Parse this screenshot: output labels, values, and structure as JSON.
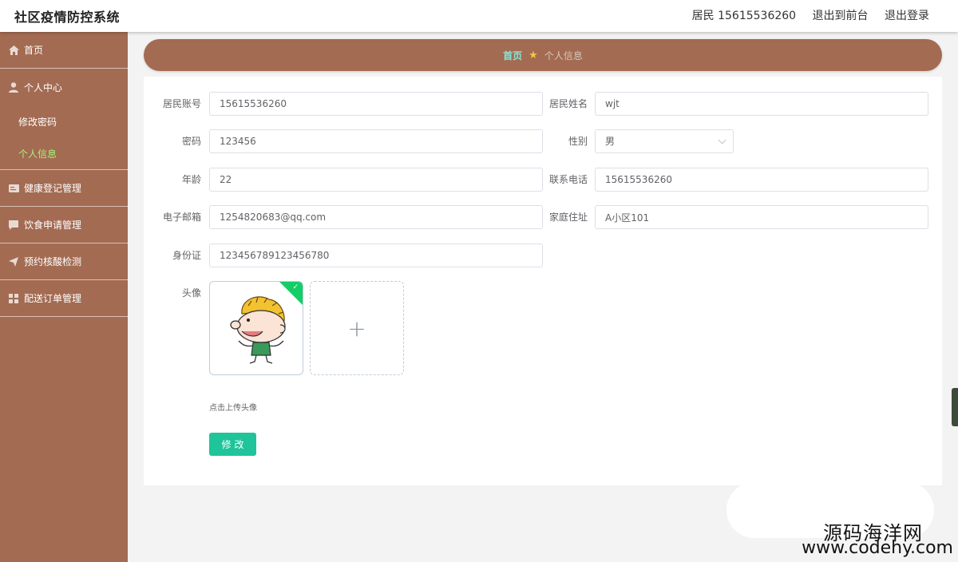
{
  "header": {
    "app_title": "社区疫情防控系统",
    "user_label": "居民 15615536260",
    "to_front": "退出到前台",
    "logout": "退出登录"
  },
  "sidebar": {
    "home": "首页",
    "personal_center": "个人中心",
    "change_password": "修改密码",
    "personal_info": "个人信息",
    "health_register": "健康登记管理",
    "diet_apply": "饮食申请管理",
    "appointment_test": "预约核酸检测",
    "delivery_orders": "配送订单管理"
  },
  "breadcrumb": {
    "home": "首页",
    "current": "个人信息"
  },
  "form": {
    "account_label": "居民账号",
    "account_value": "15615536260",
    "name_label": "居民姓名",
    "name_value": "wjt",
    "password_label": "密码",
    "password_value": "123456",
    "gender_label": "性别",
    "gender_value": "男",
    "age_label": "年龄",
    "age_value": "22",
    "phone_label": "联系电话",
    "phone_value": "15615536260",
    "email_label": "电子邮箱",
    "email_value": "1254820683@qq.com",
    "address_label": "家庭住址",
    "address_value": "A小区101",
    "idcard_label": "身份证",
    "idcard_value": "123456789123456780",
    "avatar_label": "头像",
    "upload_hint": "点击上传头像",
    "submit": "修改"
  },
  "watermark": {
    "cn": "源码海洋网",
    "url": "www.codehy.com"
  },
  "colors": {
    "sidebar_bg": "#a36b52",
    "active_sub": "#a8f07a",
    "breadcrumb_home": "#86e6d9",
    "primary_button": "#1fc49a",
    "upload_success": "#13ce66"
  },
  "icons": {
    "home": "home-icon",
    "personal_center": "person-icon",
    "health_register": "card-icon",
    "diet_apply": "chat-icon",
    "appointment_test": "send-icon",
    "delivery_orders": "grid-icon",
    "breadcrumb_sep": "star-icon",
    "upload": "plus-icon",
    "uploaded": "check-icon"
  }
}
